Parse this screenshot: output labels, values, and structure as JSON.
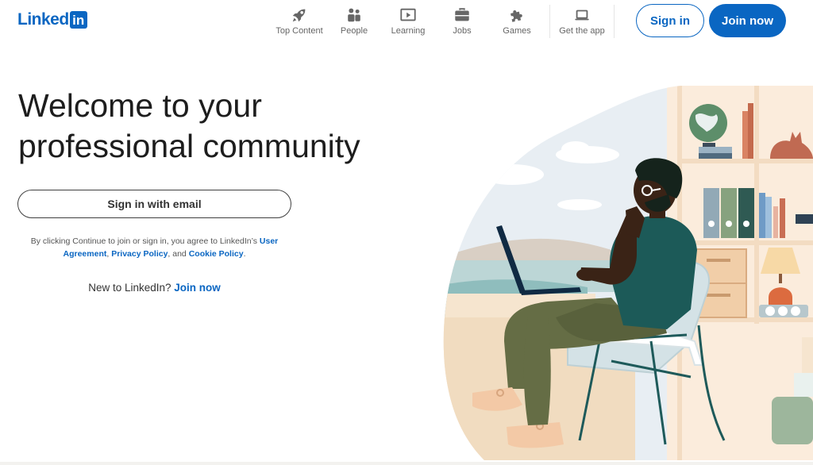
{
  "brand": {
    "logo_text": "Linked",
    "logo_in": "in",
    "color": "#0a66c2"
  },
  "nav": {
    "items": [
      {
        "label": "Top Content",
        "icon": "rocket-icon"
      },
      {
        "label": "People",
        "icon": "people-icon"
      },
      {
        "label": "Learning",
        "icon": "learning-icon"
      },
      {
        "label": "Jobs",
        "icon": "briefcase-icon"
      },
      {
        "label": "Games",
        "icon": "puzzle-icon"
      },
      {
        "label": "Get the app",
        "icon": "laptop-icon"
      }
    ]
  },
  "header": {
    "sign_in_label": "Sign in",
    "join_now_label": "Join now"
  },
  "hero": {
    "title": "Welcome to your professional community",
    "email_button": "Sign in with email",
    "legal": {
      "prefix": "By clicking Continue to join or sign in, you agree to LinkedIn’s ",
      "user_agreement": "User Agreement",
      "sep1": ", ",
      "privacy_policy": "Privacy Policy",
      "sep2": ", and ",
      "cookie_policy": "Cookie Policy",
      "suffix": "."
    },
    "new_prefix": "New to LinkedIn? ",
    "new_join": "Join now"
  },
  "colors": {
    "accent": "#0a66c2",
    "text": "#1d1d1d",
    "muted": "#666666"
  }
}
